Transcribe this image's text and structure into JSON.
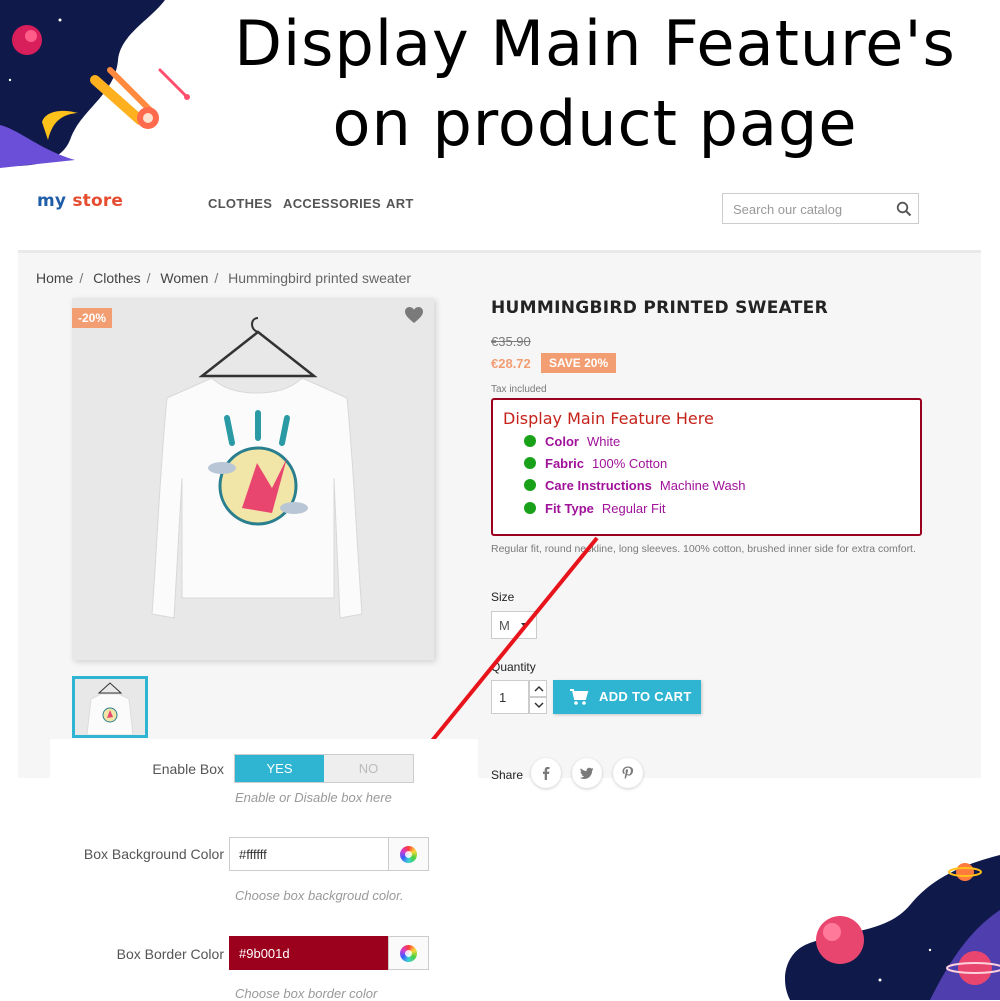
{
  "banner": {
    "title_line1": "Display Main Feature's",
    "title_line2": "on product page"
  },
  "store": {
    "logo_my": "my",
    "logo_store": "store",
    "nav": [
      "CLOTHES",
      "ACCESSORIES",
      "ART"
    ],
    "search_placeholder": "Search our catalog",
    "breadcrumb": [
      "Home",
      "Clothes",
      "Women",
      "Hummingbird printed sweater"
    ],
    "discount_flag": "-20%",
    "product": {
      "title": "HUMMINGBIRD PRINTED SWEATER",
      "old_price": "€35.90",
      "new_price": "€28.72",
      "save_badge": "SAVE 20%",
      "tax_note": "Tax included",
      "description": "Regular fit, round neckline, long sleeves. 100% cotton, brushed inner side for extra comfort.",
      "size_label": "Size",
      "size_value": "M",
      "quantity_label": "Quantity",
      "quantity_value": "1",
      "add_to_cart": "ADD TO CART",
      "share_label": "Share"
    },
    "feature_box": {
      "title": "Display Main Feature Here",
      "features": [
        {
          "name": "Color",
          "value": "White"
        },
        {
          "name": "Fabric",
          "value": "100% Cotton"
        },
        {
          "name": "Care Instructions",
          "value": "Machine Wash"
        },
        {
          "name": "Fit Type",
          "value": "Regular Fit"
        }
      ],
      "border_color": "#9b001d",
      "dot_color": "#1aa11a"
    }
  },
  "admin": {
    "enable_box_label": "Enable Box",
    "toggle_yes": "YES",
    "toggle_no": "NO",
    "enable_hint": "Enable or Disable box here",
    "bg_color_label": "Box Background Color",
    "bg_color_value": "#ffffff",
    "bg_color_hint": "Choose box backgroud color.",
    "border_color_label": "Box Border Color",
    "border_color_value": "#9b001d",
    "border_color_hint": "Choose box border color"
  },
  "colors": {
    "accent": "#2fb5d2",
    "discount": "#f39d72",
    "annotation_arrow": "#e8141c"
  }
}
